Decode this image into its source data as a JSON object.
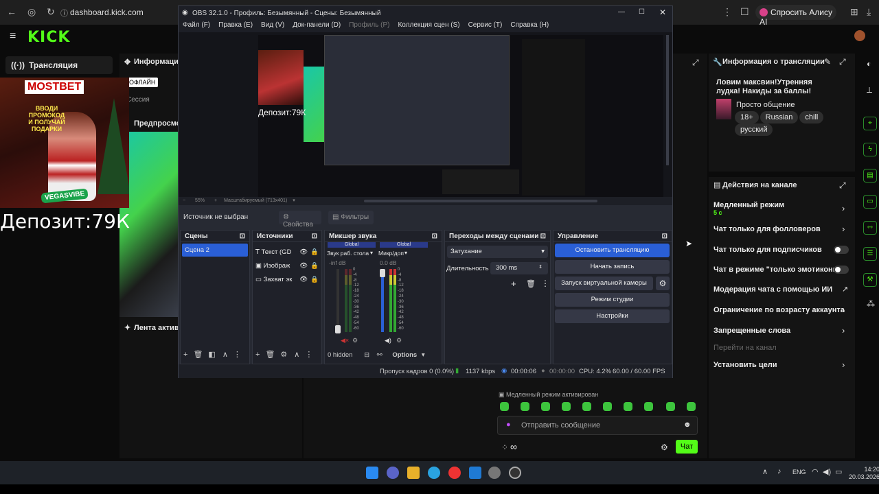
{
  "browser": {
    "url": "dashboard.kick.com",
    "alice_button": "Спросить Алису AI"
  },
  "kick": {
    "logo": "KICK",
    "nav_item": "Трансляция",
    "info_header": "Информация",
    "offline_badge": "ОФЛАЙН",
    "session_label": "Сессия",
    "preview_label": "Предпросмотр",
    "activity_label": "Лента активн",
    "promo": {
      "brand": "MOSTBET",
      "slogan": "ВВОДИ ПРОМОКОД И ПОЛУЧАЙ ПОДАРКИ",
      "tag": "VEGASVIBE"
    },
    "deposit_text": "Депозит:79К"
  },
  "stream_info": {
    "title": "Информация о трансляции",
    "stream_title": "Ловим максвин!Утренняя лудка! Накиды за баллы!",
    "category": "Просто общение",
    "tags": [
      "18+",
      "Russian",
      "chill",
      "русский"
    ]
  },
  "channel_actions": {
    "title": "Действия на канале",
    "slow_mode": "Медленный режим",
    "slow_mode_value": "5 с",
    "followers_only": "Чат только для фолловеров",
    "subs_only": "Чат только для подписчиков",
    "emotes_only": "Чат в режиме \"только эмотиконы\"",
    "ai_moderation": "Модерация чата с помощью ИИ",
    "age_restriction": "Ограничение по возрасту аккаунта",
    "banned_words": "Запрещенные слова",
    "goto_channel": "Перейти на канал",
    "set_goals": "Установить цели"
  },
  "chat": {
    "slow_mode_notice": "Медленный режим активирован",
    "placeholder": "Отправить сообщение",
    "send_button": "Чат",
    "infinity": "∞"
  },
  "obs": {
    "title": "OBS 32.1.0 - Профиль: Безымянный - Сцены: Безымянный",
    "menu": [
      "Файл (F)",
      "Правка (E)",
      "Вид (V)",
      "Док-панели (D)",
      "Профиль (P)",
      "Коллекция сцен (S)",
      "Сервис (T)",
      "Справка (H)"
    ],
    "zoom_text": "Масштабируемый (713х401)",
    "zoom_value": "55%",
    "no_source": "Источник не выбран",
    "properties": "Свойства",
    "filters": "Фильтры",
    "scenes_title": "Сцены",
    "scenes": [
      "Сцена 2"
    ],
    "sources_title": "Источники",
    "sources": [
      "Текст (GD",
      "Изображ",
      "Захват эк"
    ],
    "mixer_title": "Микшер звука",
    "mixer_global": "Global",
    "mixer_channels": [
      {
        "name": "Звук раб. стола",
        "level": "-inf dB"
      },
      {
        "name": "Микр/доп",
        "level": "0.0 dB"
      }
    ],
    "mixer_scale": [
      "0",
      "-4",
      "-8",
      "-12",
      "-18",
      "-24",
      "-30",
      "-36",
      "-42",
      "-48",
      "-54",
      "-60"
    ],
    "hidden_count": "0 hidden",
    "options": "Options",
    "transitions_title": "Переходы между сценами",
    "transition": "Затухание",
    "duration_label": "Длительность",
    "duration_value": "300 ms",
    "controls_title": "Управление",
    "controls": [
      "Остановить трансляцию",
      "Начать запись",
      "Запуск виртуальной камеры",
      "Режим студии",
      "Настройки"
    ],
    "status": {
      "dropped": "Пропуск кадров 0 (0.0%)",
      "bitrate": "1137 kbps",
      "stream_time": "00:00:06",
      "rec_time": "00:00:00",
      "cpu": "CPU: 4.2%",
      "fps": "60.00 / 60.00 FPS"
    }
  },
  "taskbar": {
    "lang": "ENG",
    "time": "14:20",
    "date": "20.03.2026"
  },
  "colors": {
    "kick_green": "#53fc18",
    "obs_accent": "#2a5fd6"
  }
}
